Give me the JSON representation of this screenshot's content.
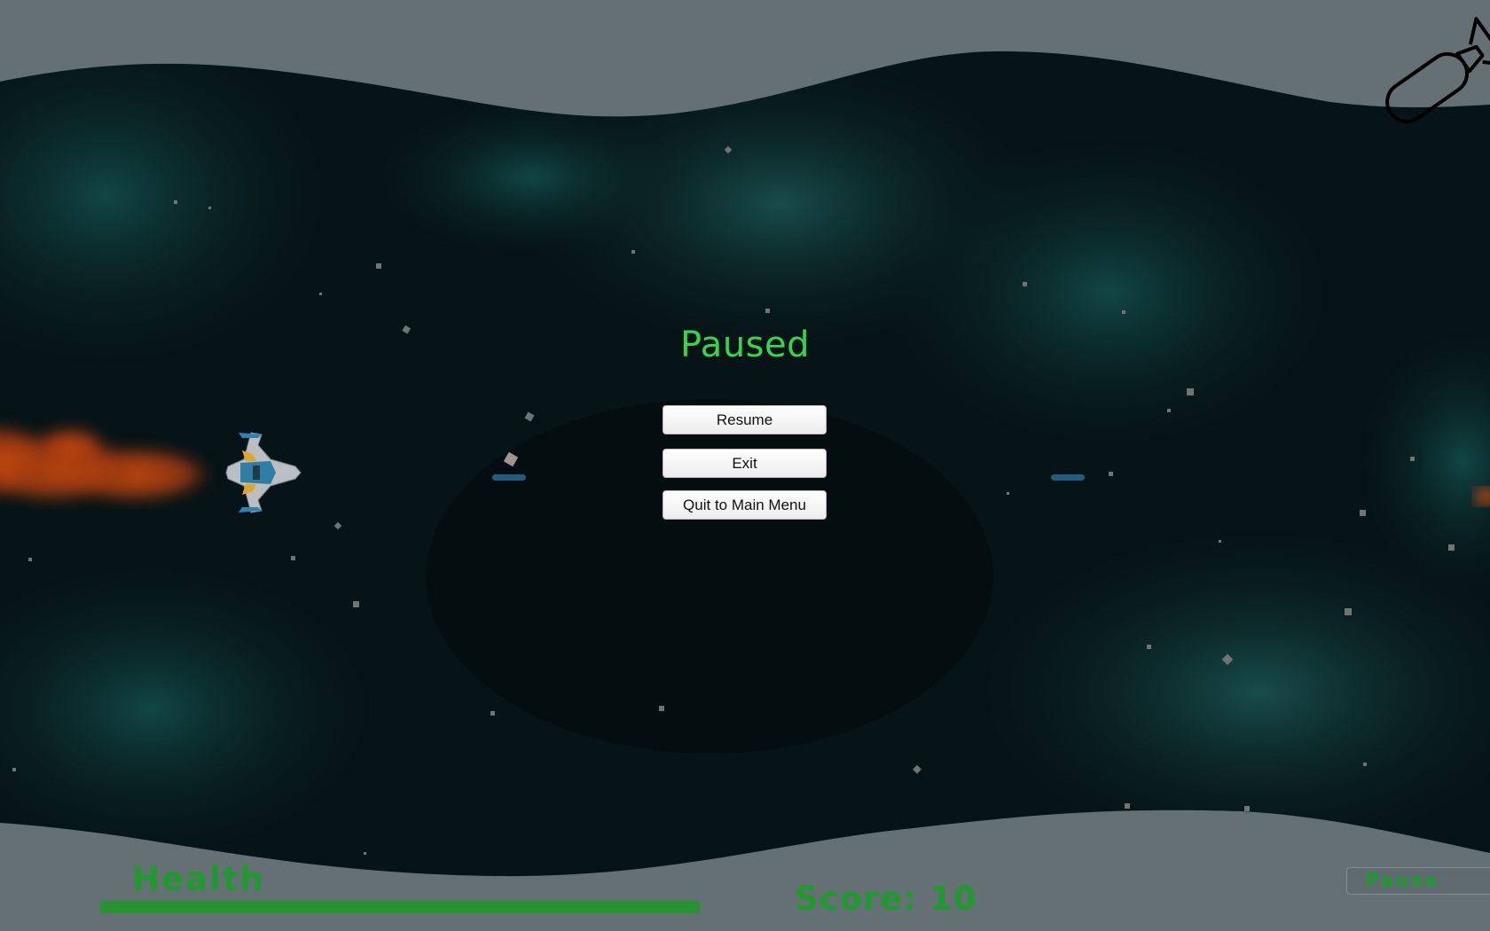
{
  "pause_menu": {
    "title": "Paused",
    "resume_label": "Resume",
    "exit_label": "Exit",
    "quit_label": "Quit to Main Menu"
  },
  "hud": {
    "health_label": "Health",
    "health_fraction": 1.0,
    "score_text": "Score: 10",
    "pause_label": "Pause"
  },
  "icons": {
    "bomb": "bomb-icon",
    "player_ship": "player-ship",
    "enemy_laser": "laser-bolt"
  },
  "colors": {
    "title_green": "#36d64a",
    "hud_green": "#1f9a2e",
    "frame_gray": "#647074",
    "space_dark": "#05191c",
    "laser_blue": "#1f5d80",
    "exhaust_orange": "#d8480e"
  }
}
